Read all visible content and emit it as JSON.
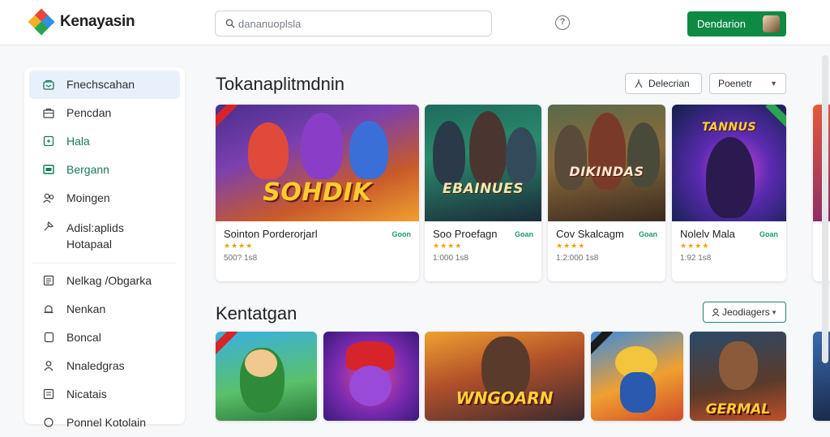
{
  "app": {
    "name": "Kenayasin"
  },
  "search": {
    "placeholder": "dananuoplsla"
  },
  "header": {
    "help_icon": "question-icon",
    "download_label": "Dendarion"
  },
  "sidebar": {
    "items": [
      {
        "label": "Fnechscahan",
        "icon": "store-icon"
      },
      {
        "label": "Pencdan",
        "icon": "bag-icon"
      },
      {
        "label": "Hala",
        "icon": "gamepad-icon"
      },
      {
        "label": "Bergann",
        "icon": "tablet-icon"
      },
      {
        "label": "Moingen",
        "icon": "people-icon"
      },
      {
        "label": "Adisl:aplids Hotapaal",
        "icon": "tag-icon"
      },
      {
        "label": "Nelkag /Obgarka",
        "icon": "grid-icon"
      },
      {
        "label": "Nenkan",
        "icon": "bell-icon"
      },
      {
        "label": "Boncal",
        "icon": "bookmark-icon"
      },
      {
        "label": "Nnaledgras",
        "icon": "person-icon"
      },
      {
        "label": "Nicatais",
        "icon": "list-icon"
      },
      {
        "label": "Ponnel Kotolain",
        "icon": "settings-icon"
      }
    ]
  },
  "section1": {
    "title": "Tokanaplitmdnin",
    "filter_label": "Delecrian",
    "sort_label": "Poenetr",
    "cards": [
      {
        "name": "Sointon Porderorjarl",
        "tag": "Goon",
        "stars": "★★★★",
        "count": "500? 1s8",
        "art_title": "SOHDIK"
      },
      {
        "name": "Soo Proefagn",
        "tag": "Goan",
        "stars": "★★★★",
        "count": "1:000 1s8",
        "art_title": "EBAINUES"
      },
      {
        "name": "Cov Skalcagm",
        "tag": "Goan",
        "stars": "★★★★",
        "count": "1:2:000 1s8",
        "art_title": "DIKINDAS"
      },
      {
        "name": "Nolelv Mala",
        "tag": "Goan",
        "stars": "★★★★",
        "count": "1:92 1s8",
        "art_title": "TANNUS"
      }
    ]
  },
  "section2": {
    "title": "Kentatgan",
    "filter_label": "Jeodiagers",
    "cards": [
      {
        "art_title": ""
      },
      {
        "art_title": ""
      },
      {
        "art_title": "WNGOARN"
      },
      {
        "art_title": ""
      },
      {
        "art_title": "GERMAL"
      }
    ]
  },
  "colors": {
    "brand_green": "#0f8a44",
    "accent_teal": "#1c8a74",
    "sidebar_active": "#e8f1fb"
  }
}
